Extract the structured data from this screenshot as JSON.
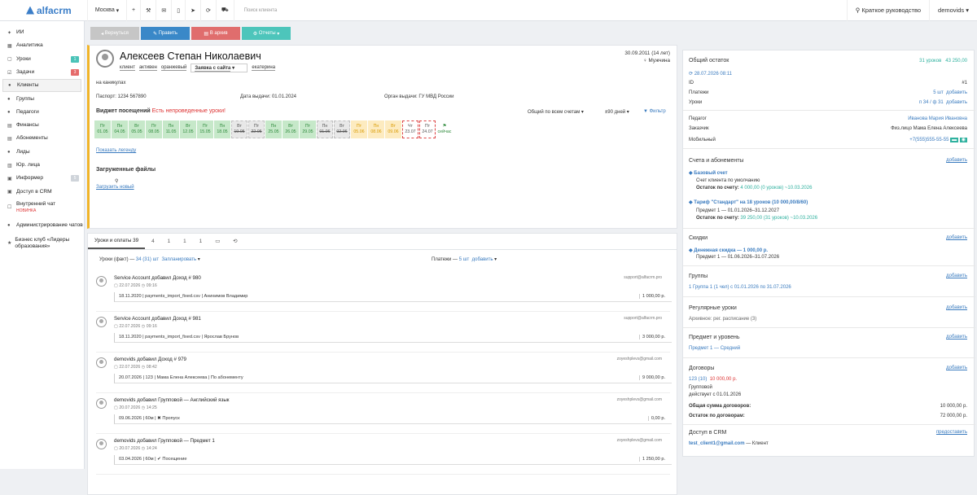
{
  "topbar": {
    "logo": "alfacrm",
    "city": "Москва",
    "search": "Поиск клиента",
    "guide": "Краткое руководство",
    "user": "demovids"
  },
  "sidebar": [
    {
      "icon": "✦",
      "label": "ИИ"
    },
    {
      "icon": "▦",
      "label": "Аналитика"
    },
    {
      "icon": "▢",
      "label": "Уроки",
      "badge": "1",
      "bc": "#4ac3b8"
    },
    {
      "icon": "☑",
      "label": "Задачи",
      "badge": "3",
      "bc": "#e56b6b"
    },
    {
      "icon": "●",
      "label": "Клиенты"
    },
    {
      "icon": "●",
      "label": "Группы"
    },
    {
      "icon": "●",
      "label": "Педагоги"
    },
    {
      "icon": "▤",
      "label": "Финансы"
    },
    {
      "icon": "▤",
      "label": "Абонементы"
    },
    {
      "icon": "●",
      "label": "Лиды"
    },
    {
      "icon": "▥",
      "label": "Юр. лица"
    },
    {
      "icon": "▣",
      "label": "Информер",
      "badge": "5",
      "bc": "#cfd4da"
    },
    {
      "icon": "▣",
      "label": "Доступ в CRM"
    },
    {
      "icon": "☐",
      "label": "Внутренний чат",
      "sub": "НОВИНКА"
    },
    {
      "icon": "●",
      "label": "Администрирование чатов"
    },
    {
      "icon": "★",
      "label": "Бизнес клуб «Лидеры образования»"
    }
  ],
  "actions": {
    "back": "Вернуться",
    "edit": "Править",
    "archive": "В архив",
    "reports": "Отчеты"
  },
  "client": {
    "name": "Алексеев Степан Николаевич",
    "birth": "30.09.2011 (14 лет)",
    "gender": "Мужчина",
    "tags": [
      "клиент",
      "активен",
      "оранжевый"
    ],
    "source": "Заявка с сайта",
    "manager": "екатерина",
    "note": "на каникулах",
    "passport": "Паспорт: 1234 567890",
    "issue_date": "Дата выдачи: 01.01.2024",
    "issuer": "Орган выдачи: ГУ МВД России"
  },
  "widget": {
    "title": "Виджет посещений",
    "warn": "Есть непроведенные уроки!",
    "scope": "Общий по всем счетам",
    "range": "±90 дней",
    "filter": "Фильтр",
    "legend": "Показать легенду"
  },
  "days": [
    {
      "w": "Пт",
      "d": "01.05",
      "c": "g"
    },
    {
      "w": "Пн",
      "d": "04.05",
      "c": "g"
    },
    {
      "w": "Вт",
      "d": "05.05",
      "c": "g"
    },
    {
      "w": "Пт",
      "d": "08.05",
      "c": "g"
    },
    {
      "w": "Пн",
      "d": "11.05",
      "c": "g"
    },
    {
      "w": "Вт",
      "d": "12.05",
      "c": "g"
    },
    {
      "w": "Пт",
      "d": "15.05",
      "c": "g"
    },
    {
      "w": "Пн",
      "d": "18.05",
      "c": "g"
    },
    {
      "w": "Вт",
      "d": "19.05",
      "c": "d"
    },
    {
      "w": "Пт",
      "d": "22.05",
      "c": "d"
    },
    {
      "w": "Пн",
      "d": "25.05",
      "c": "g"
    },
    {
      "w": "Вт",
      "d": "26.05",
      "c": "g"
    },
    {
      "w": "Пт",
      "d": "29.05",
      "c": "g"
    },
    {
      "w": "Пн",
      "d": "01.06",
      "c": "d"
    },
    {
      "w": "Вт",
      "d": "02.06",
      "c": "d"
    },
    {
      "w": "Пт",
      "d": "05.06",
      "c": "y"
    },
    {
      "w": "Пн",
      "d": "08.06",
      "c": "y"
    },
    {
      "w": "Вт",
      "d": "09.06",
      "c": "y"
    },
    {
      "w": "Чт",
      "d": "23.07",
      "c": "r"
    },
    {
      "w": "Пт",
      "d": "24.07",
      "c": "r"
    },
    {
      "w": "⚑",
      "d": "сейчас",
      "c": "gg"
    }
  ],
  "files": {
    "title": "Загруженные файлы",
    "upload": "Загрузить новый"
  },
  "tabs": [
    {
      "label": "Уроки и оплаты 39"
    },
    {
      "label": "4"
    },
    {
      "label": "1"
    },
    {
      "label": "1"
    },
    {
      "label": "1"
    },
    {
      "label": "▭"
    },
    {
      "label": "⟲"
    }
  ],
  "feedhead": {
    "lessons": "Уроки (факт) —",
    "lcount": "34 (31) шт",
    "planned": "Запланировать",
    "payments": "Платежи —",
    "pcount": "5 шт",
    "add": "добавить"
  },
  "feed": [
    {
      "who": "Service Account",
      "act": "добавил Доход # 980",
      "date": "22.07.2026",
      "time": "09:16",
      "email": "support@alfacrm.pro",
      "line": "18.11.2020 | payments_import_fixed.csv | Анихимов Владимир",
      "amount": "1 000,00 р."
    },
    {
      "who": "Service Account",
      "act": "добавил Доход # 981",
      "date": "22.07.2026",
      "time": "09:16",
      "email": "support@alfacrm.pro",
      "line": "18.11.2020 | payments_import_fixed.csv | Ярослав Брунов",
      "amount": "3 000,00 р."
    },
    {
      "who": "demovids",
      "act": "добавил Доход # 979",
      "date": "22.07.2026",
      "time": "08:42",
      "email": "zoyeshplevs@gmail.com",
      "line": "20.07.2026 | 123 | Мама Елена Алексеева | По абонементу",
      "amount": "9 000,00 р."
    },
    {
      "who": "demovids",
      "act": "добавил Групповой — Английский язык",
      "date": "20.07.2026",
      "time": "14:25",
      "email": "zoyeshplevs@gmail.com",
      "line": "09.06.2026 | 60м | ✖ Пропуск",
      "amount": "0,00 р."
    },
    {
      "who": "demovids",
      "act": "добавил Групповой — Предмет 1",
      "date": "20.07.2026",
      "time": "14:24",
      "email": "zoyeshplevs@gmail.com",
      "line": "03.04.2026 | 60м | ✔ Посещение",
      "amount": "1 250,00 р."
    }
  ],
  "balance": {
    "title": "Общий остаток",
    "lessons": "31 уроков",
    "money": "43 250,00",
    "date": "28.07.2026 08:11",
    "id_label": "ID",
    "id": "#1",
    "pay_label": "Платежи",
    "pay": "5 шт",
    "less_label": "Уроки",
    "less": "п 34 / ф 31",
    "add": "добавить"
  },
  "info": {
    "teacher_label": "Педагог",
    "teacher": "Иванова Мария Ивановна",
    "cust_label": "Заказчик",
    "cust": "Физ.лицо Мама Елена Алексеева",
    "mob_label": "Мобильный",
    "mob": "+7(555)555-55-55"
  },
  "accounts": {
    "title": "Счета и абонементы",
    "add": "добавить",
    "base": "Базовый счет",
    "base_sub": "Счет клиента по умолчанию",
    "base_bal": "Остаток по счету:",
    "base_val": "4 000,00 (0 уроков) ~10.03.2026",
    "tariff": "Тариф \"Стандарт\" на 18 уроков (10 000,00/8/60)",
    "tariff_sub": "Предмет 1 — 01.01.2026–31.12.2027",
    "tariff_bal": "Остаток по счету:",
    "tariff_val": "39 250,00 (31 уроков) ~10.03.2026"
  },
  "discounts": {
    "title": "Скидки",
    "add": "добавить",
    "item": "Денежная скидка — 1 000,00 р.",
    "sub": "Предмет 1 — 01.06.2026–31.07.2026"
  },
  "groups": {
    "title": "Группы",
    "add": "добавить",
    "item": "1 Группа 1 (1 чел) с 01.01.2026 по 31.07.2026"
  },
  "regular": {
    "title": "Регулярные уроки",
    "add": "добавить",
    "item": "Архивное: рег. расписание (3)"
  },
  "subject": {
    "title": "Предмет и уровень",
    "add": "добавить",
    "item": "Предмет 1 — Средний"
  },
  "contracts": {
    "title": "Договоры",
    "add": "добавить",
    "item": "123 (10)",
    "sum": "10 000,00 р.",
    "type": "Групповой",
    "since": "действует с 01.01.2026",
    "total_l": "Общая сумма договоров:",
    "total": "10 000,00 р.",
    "rest_l": "Остаток по договорам:",
    "rest": "72 000,00 р."
  },
  "crm": {
    "title": "Доступ в CRM",
    "act": "предоставить",
    "email": "test_client1@gmail.com",
    "role": "— Клиент"
  }
}
